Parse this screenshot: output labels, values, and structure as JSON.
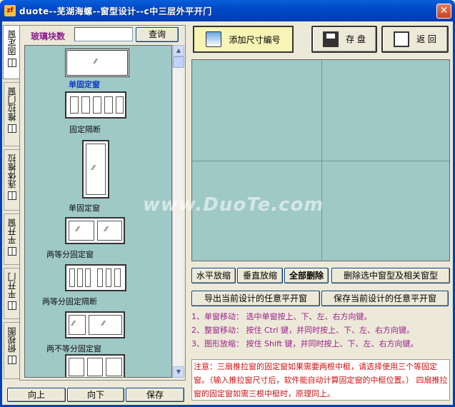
{
  "window": {
    "title": "duote--芜湖海螺--窗型设计--c中三层外平开门",
    "close": "✕"
  },
  "tabs": [
    {
      "label": "固定窗"
    },
    {
      "label": "推拉门窗"
    },
    {
      "label": "连体推拉"
    },
    {
      "label": "平开窗"
    },
    {
      "label": "平开门"
    },
    {
      "label": "俯视图"
    }
  ],
  "left": {
    "glass_label": "玻璃块数",
    "glass_value": "",
    "query_button": "查询",
    "scroll_up": "▲",
    "scroll_down": "▼",
    "items": [
      {
        "caption": "单固定窗",
        "selected": true
      },
      {
        "caption": "固定隔断",
        "selected": false
      },
      {
        "caption": "单固定窗",
        "selected": false
      },
      {
        "caption": "两等分固定窗",
        "selected": false
      },
      {
        "caption": "两等分固定隔断",
        "selected": false
      },
      {
        "caption": "两不等分固定窗",
        "selected": false
      },
      {
        "caption": "",
        "selected": false
      }
    ],
    "btn_up": "向上",
    "btn_down": "向下",
    "btn_save": "保存"
  },
  "toolbar": {
    "add_size_no": "添加尺寸编号",
    "save": "存 盘",
    "back": "返 回"
  },
  "actions": {
    "h_scale": "水平放缩",
    "v_scale": "垂直放缩",
    "delete_all": "全部删除",
    "delete_selected": "删除选中窗型及相关窗型",
    "export_design": "导出当前设计的任意平开窗",
    "save_design": "保存当前设计的任意平开窗"
  },
  "help": [
    "1、单窗移动： 选中单窗按上、下、左、右方向键。",
    "2、整窗移动： 按住 Ctrl 键，并同时按上、下、左、右方向键。",
    "3、图形放缩： 按住 Shift 键，并同时按上、下、左、右方向键。"
  ],
  "note": "注意：三扇推拉窗的固定窗如果需要两根中梃，请选择使用三个等固定窗。（输入推拉窗尺寸后，软件能自动计算固定窗的中梃位置。） 四扇推拉窗的固定窗如需三根中梃时，原理同上。",
  "watermark": "www.DuoTe.com"
}
